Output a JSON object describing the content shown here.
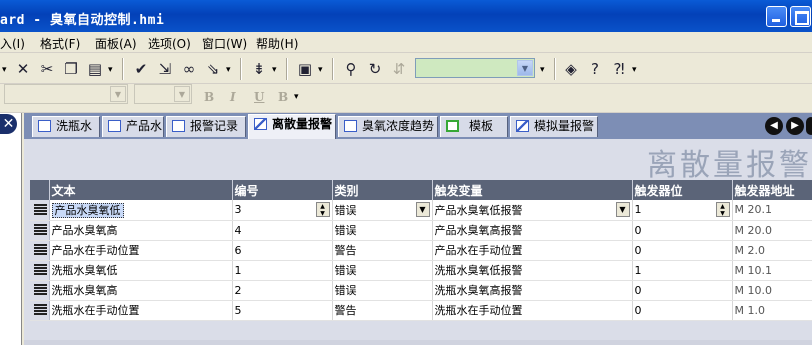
{
  "window": {
    "title": "ard - 臭氧自动控制.hmi",
    "minimize_icon": "minimize-icon",
    "maximize_icon": "maximize-icon"
  },
  "menu": [
    {
      "label": "入(I)"
    },
    {
      "label": "格式(F)"
    },
    {
      "label": "面板(A)"
    },
    {
      "label": "选项(O)"
    },
    {
      "label": "窗口(W)"
    },
    {
      "label": "帮助(H)"
    }
  ],
  "toolbar1": {
    "icons": [
      "delete-icon",
      "cut-icon",
      "copy-icon",
      "paste-icon",
      "check-icon",
      "export-icon",
      "link-icon",
      "import-icon",
      "align-icon",
      "layers-icon",
      "find-icon",
      "replace-icon",
      "replace-disabled-icon",
      "book-icon",
      "help-icon",
      "context-help-icon"
    ],
    "combo_value": ""
  },
  "toolbar2": {
    "font_combo": "",
    "size_combo": "",
    "bold": "B",
    "italic": "I",
    "underline": "U",
    "format_b": "B"
  },
  "tabs": [
    {
      "label": "洗瓶水"
    },
    {
      "label": "产品水"
    },
    {
      "label": "报警记录"
    },
    {
      "label": "离散量报警"
    },
    {
      "label": "臭氧浓度趋势"
    },
    {
      "label": "模板"
    },
    {
      "label": "模拟量报警"
    }
  ],
  "active_tab": "离散量报警",
  "page_heading": "离散量报警",
  "table": {
    "columns": [
      "文本",
      "编号",
      "类别",
      "触发变量",
      "触发器位",
      "触发器地址"
    ],
    "rows": [
      {
        "text": "产品水臭氧低",
        "id": "3",
        "category": "错误",
        "trigger_var": "产品水臭氧低报警",
        "bit": "1",
        "address": "M 20.1"
      },
      {
        "text": "产品水臭氧高",
        "id": "4",
        "category": "错误",
        "trigger_var": "产品水臭氧高报警",
        "bit": "0",
        "address": "M 20.0"
      },
      {
        "text": "产品水在手动位置",
        "id": "6",
        "category": "警告",
        "trigger_var": "产品水在手动位置",
        "bit": "0",
        "address": "M 2.0"
      },
      {
        "text": "洗瓶水臭氧低",
        "id": "1",
        "category": "错误",
        "trigger_var": "洗瓶水臭氧低报警",
        "bit": "1",
        "address": "M 10.1"
      },
      {
        "text": "洗瓶水臭氧高",
        "id": "2",
        "category": "错误",
        "trigger_var": "洗瓶水臭氧高报警",
        "bit": "0",
        "address": "M 10.0"
      },
      {
        "text": "洗瓶水在手动位置",
        "id": "5",
        "category": "警告",
        "trigger_var": "洗瓶水在手动位置",
        "bit": "0",
        "address": "M 1.0"
      }
    ]
  }
}
